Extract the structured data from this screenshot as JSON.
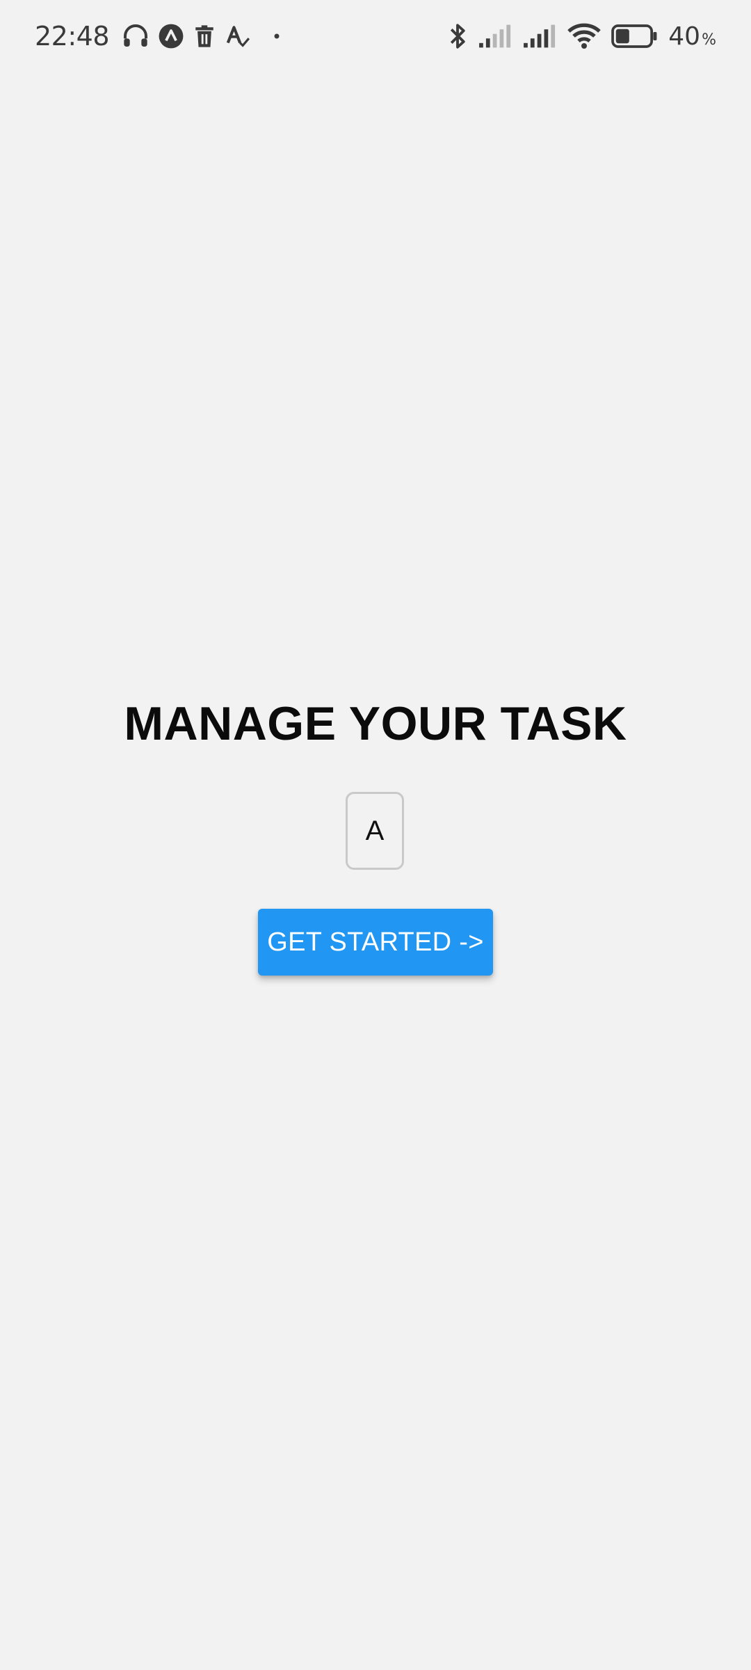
{
  "status_bar": {
    "time": "22:48",
    "left_icons": [
      "headphones-icon",
      "app-notification-icon",
      "trash-icon",
      "spellcheck-icon",
      "dot-icon"
    ],
    "right_icons": [
      "bluetooth-icon",
      "signal-1-icon",
      "signal-2-icon",
      "wifi-icon",
      "battery-icon"
    ],
    "battery_level": 40,
    "battery_text": "40",
    "battery_unit": "%"
  },
  "main": {
    "title": "MANAGE YOUR TASK",
    "logo_letter": "A",
    "cta_label": "GET STARTED ->"
  },
  "colors": {
    "background": "#f2f2f2",
    "accent": "#2196f3",
    "title": "#0b0b0b"
  }
}
